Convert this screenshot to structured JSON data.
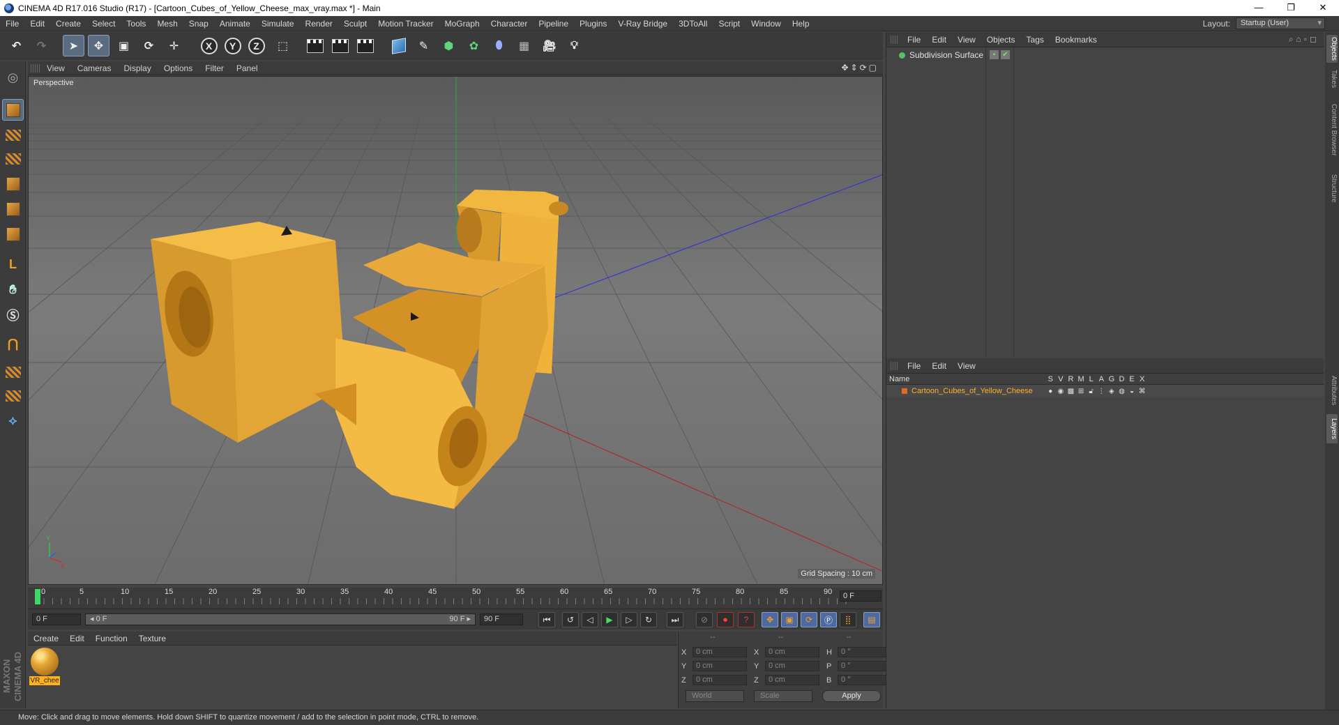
{
  "window": {
    "title": "CINEMA 4D R17.016 Studio (R17) - [Cartoon_Cubes_of_Yellow_Cheese_max_vray.max *] - Main",
    "controls": [
      "—",
      "❐",
      "✕"
    ]
  },
  "menubar": {
    "items": [
      "File",
      "Edit",
      "Create",
      "Select",
      "Tools",
      "Mesh",
      "Snap",
      "Animate",
      "Simulate",
      "Render",
      "Sculpt",
      "Motion Tracker",
      "MoGraph",
      "Character",
      "Pipeline",
      "Plugins",
      "V-Ray Bridge",
      "3DToAll",
      "Script",
      "Window",
      "Help"
    ],
    "layout_label": "Layout:",
    "layout_value": "Startup (User)"
  },
  "viewport": {
    "menu": [
      "View",
      "Cameras",
      "Display",
      "Options",
      "Filter",
      "Panel"
    ],
    "nav_icons": "✥⇕⟳▢",
    "camera_label": "Perspective",
    "grid_spacing": "Grid Spacing : 10 cm",
    "axis_labels": {
      "y": "Y",
      "x": "X"
    }
  },
  "timeline": {
    "ticks": [
      "0",
      "5",
      "10",
      "15",
      "20",
      "25",
      "30",
      "35",
      "40",
      "45",
      "50",
      "55",
      "60",
      "65",
      "70",
      "75",
      "80",
      "85",
      "90"
    ],
    "current_frame": "0 F"
  },
  "transport": {
    "start_field": "0 F",
    "range_start": "◂ 0 F",
    "range_end": "90 F ▸",
    "end_field": "90 F",
    "buttons": [
      "⏮",
      "↺",
      "◁",
      "▶",
      "▷",
      "↻",
      "⏭"
    ]
  },
  "materials": {
    "menu": [
      "Create",
      "Edit",
      "Function",
      "Texture"
    ],
    "items": [
      {
        "name": "VR_chee"
      }
    ]
  },
  "coordinates": {
    "headers": [
      "--",
      "--",
      "--"
    ],
    "rows": [
      {
        "a": "X",
        "av": "0 cm",
        "b": "X",
        "bv": "0 cm",
        "c": "H",
        "cv": "0 °"
      },
      {
        "a": "Y",
        "av": "0 cm",
        "b": "Y",
        "bv": "0 cm",
        "c": "P",
        "cv": "0 °"
      },
      {
        "a": "Z",
        "av": "0 cm",
        "b": "Z",
        "bv": "0 cm",
        "c": "B",
        "cv": "0 °"
      }
    ],
    "mode1": "World",
    "mode2": "Scale",
    "apply": "Apply"
  },
  "objects": {
    "menu": [
      "File",
      "Edit",
      "View",
      "Objects",
      "Tags",
      "Bookmarks"
    ],
    "items": [
      {
        "name": "Subdivision Surface"
      }
    ]
  },
  "layers": {
    "menu": [
      "File",
      "Edit",
      "View"
    ],
    "name_header": "Name",
    "columns": [
      "S",
      "V",
      "R",
      "M",
      "L",
      "A",
      "G",
      "D",
      "E",
      "X"
    ],
    "items": [
      {
        "name": "Cartoon_Cubes_of_Yellow_Cheese"
      }
    ]
  },
  "side_tabs": [
    "Objects",
    "Takes",
    "Content Browser",
    "Structure",
    "Attributes",
    "Layers"
  ],
  "status": "Move: Click and drag to move elements. Hold down SHIFT to quantize movement / add to the selection in point mode, CTRL to remove.",
  "brand": "MAXON CINEMA 4D",
  "colors": {
    "accent": "#f0a020",
    "cheese": "#f0b43c",
    "play": "#4ad96a"
  }
}
